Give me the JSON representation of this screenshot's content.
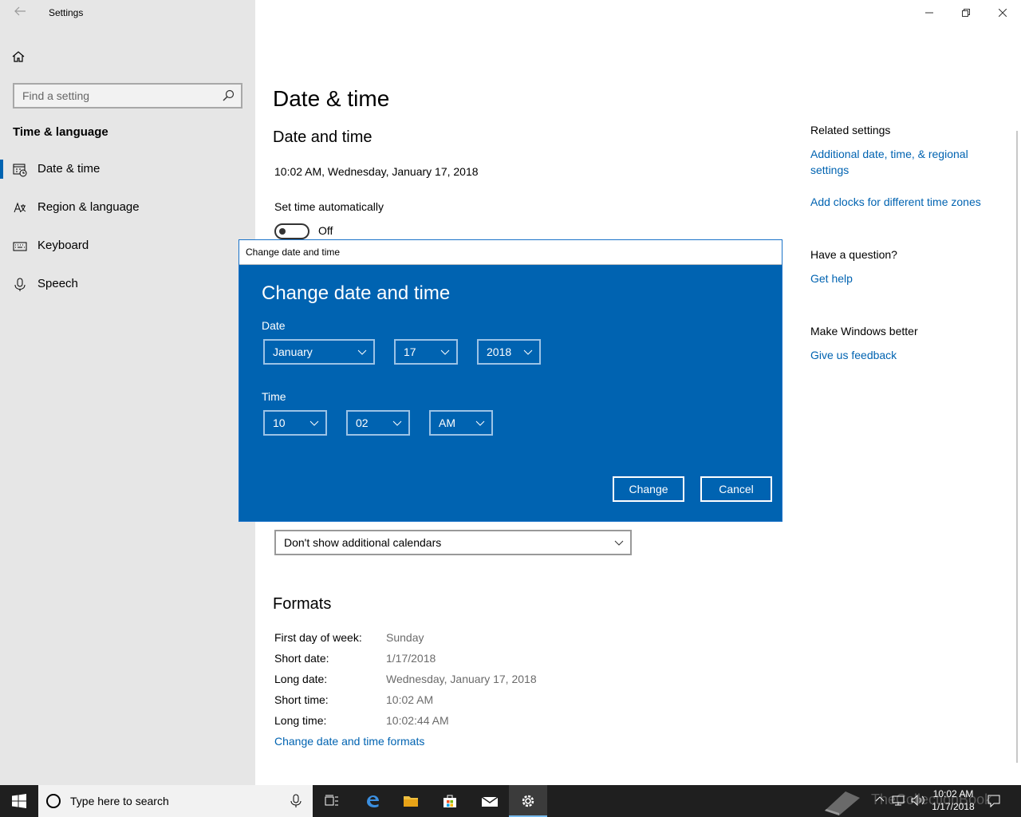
{
  "window": {
    "title": "Settings"
  },
  "search": {
    "placeholder": "Find a setting"
  },
  "sidebar": {
    "category": "Time & language",
    "items": [
      {
        "label": "Date & time",
        "icon": "calendar-clock-icon",
        "active": true
      },
      {
        "label": "Region & language",
        "icon": "region-language-icon",
        "active": false
      },
      {
        "label": "Keyboard",
        "icon": "keyboard-icon",
        "active": false
      },
      {
        "label": "Speech",
        "icon": "microphone-icon",
        "active": false
      }
    ]
  },
  "main": {
    "page_title": "Date & time",
    "section_title": "Date and time",
    "current_datetime": "10:02 AM, Wednesday, January 17, 2018",
    "set_time_auto": {
      "label": "Set time automatically",
      "state": "Off"
    },
    "calendar_dropdown": "Don't show additional calendars",
    "formats": {
      "title": "Formats",
      "rows": [
        {
          "key": "First day of week:",
          "value": "Sunday"
        },
        {
          "key": "Short date:",
          "value": "1/17/2018"
        },
        {
          "key": "Long date:",
          "value": "Wednesday, January 17, 2018"
        },
        {
          "key": "Short time:",
          "value": "10:02 AM"
        },
        {
          "key": "Long time:",
          "value": "10:02:44 AM"
        }
      ],
      "change_link": "Change date and time formats"
    }
  },
  "related": {
    "heading": "Related settings",
    "links": [
      "Additional date, time, & regional settings",
      "Add clocks for different time zones"
    ],
    "question_heading": "Have a question?",
    "help_link": "Get help",
    "better_heading": "Make Windows better",
    "feedback_link": "Give us feedback"
  },
  "dialog": {
    "window_title": "Change date and time",
    "heading": "Change date and time",
    "date_label": "Date",
    "month": "January",
    "day": "17",
    "year": "2018",
    "time_label": "Time",
    "hour": "10",
    "minute": "02",
    "ampm": "AM",
    "change_button": "Change",
    "cancel_button": "Cancel"
  },
  "taskbar": {
    "search_placeholder": "Type here to search",
    "watermark": "TheCollectionBook",
    "time": "10:02 AM",
    "date": "1/17/2018",
    "accent_color": "#0063b1"
  }
}
